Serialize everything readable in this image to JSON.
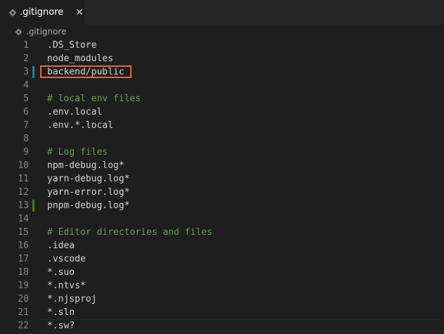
{
  "tab": {
    "label": ".gitignore",
    "close_glyph": "✕",
    "icon": "gitignore-file-icon"
  },
  "breadcrumb": {
    "file": ".gitignore"
  },
  "editor": {
    "lines": [
      {
        "num": "1",
        "text": ".DS_Store",
        "type": "plain"
      },
      {
        "num": "2",
        "text": "node_modules",
        "type": "plain"
      },
      {
        "num": "3",
        "text": "backend/public",
        "type": "plain",
        "gutter": "modified"
      },
      {
        "num": "4",
        "text": "",
        "type": "plain"
      },
      {
        "num": "5",
        "text": "# local env files",
        "type": "comment"
      },
      {
        "num": "6",
        "text": ".env.local",
        "type": "plain"
      },
      {
        "num": "7",
        "text": ".env.*.local",
        "type": "plain"
      },
      {
        "num": "8",
        "text": "",
        "type": "plain"
      },
      {
        "num": "9",
        "text": "# Log files",
        "type": "comment"
      },
      {
        "num": "10",
        "text": "npm-debug.log*",
        "type": "plain"
      },
      {
        "num": "11",
        "text": "yarn-debug.log*",
        "type": "plain"
      },
      {
        "num": "12",
        "text": "yarn-error.log*",
        "type": "plain"
      },
      {
        "num": "13",
        "text": "pnpm-debug.log*",
        "type": "plain",
        "gutter": "added"
      },
      {
        "num": "14",
        "text": "",
        "type": "plain"
      },
      {
        "num": "15",
        "text": "# Editor directories and files",
        "type": "comment"
      },
      {
        "num": "16",
        "text": ".idea",
        "type": "plain"
      },
      {
        "num": "17",
        "text": ".vscode",
        "type": "plain"
      },
      {
        "num": "18",
        "text": "*.suo",
        "type": "plain"
      },
      {
        "num": "19",
        "text": "*.ntvs*",
        "type": "plain"
      },
      {
        "num": "20",
        "text": "*.njsproj",
        "type": "plain"
      },
      {
        "num": "21",
        "text": "*.sln",
        "type": "plain"
      },
      {
        "num": "22",
        "text": "*.sw?",
        "type": "plain"
      }
    ]
  },
  "colors": {
    "background": "#1e1e1e",
    "comment": "#6a9955",
    "line_number": "#858585",
    "gutter_modified": "#1b81a8",
    "gutter_added": "#487e02",
    "highlight_box": "#e06a3b"
  }
}
